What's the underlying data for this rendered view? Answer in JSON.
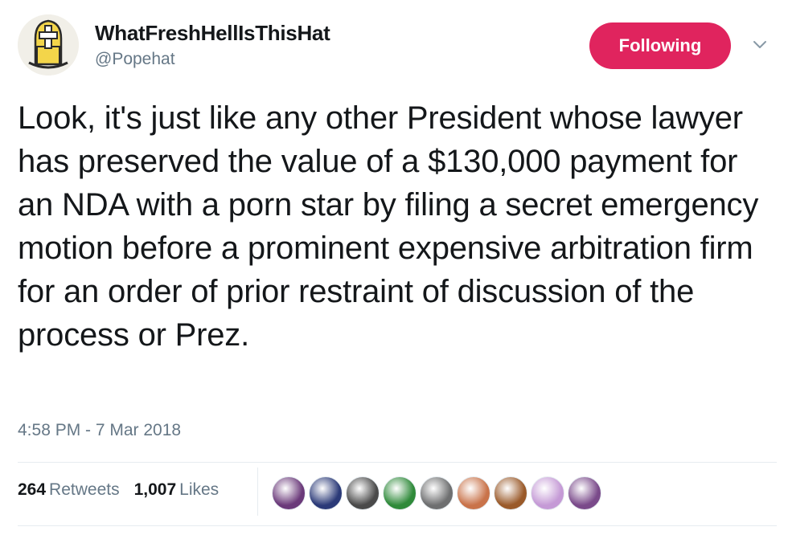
{
  "tweet": {
    "author": {
      "display_name": "WhatFreshHellIsThisHat",
      "handle": "@Popehat"
    },
    "follow_button_label": "Following",
    "text": "Look, it's just like any other President whose lawyer has preserved the value of a $130,000 payment for an NDA with a porn star by filing a secret emergency motion before a prominent expensive arbitration firm for an order of prior restraint of discussion of the process or Prez.",
    "timestamp": "4:58 PM - 7 Mar 2018",
    "stats": {
      "retweets_count": "264",
      "retweets_label": "Retweets",
      "likes_count": "1,007",
      "likes_label": "Likes"
    },
    "likers": [
      {
        "name": "liker-avatar-1",
        "color": "#6b3a7a"
      },
      {
        "name": "liker-avatar-2",
        "color": "#2b3a78"
      },
      {
        "name": "liker-avatar-3",
        "color": "#4a4a4a"
      },
      {
        "name": "liker-avatar-4",
        "color": "#2f8a3a"
      },
      {
        "name": "liker-avatar-5",
        "color": "#6e6f70"
      },
      {
        "name": "liker-avatar-6",
        "color": "#c9734a"
      },
      {
        "name": "liker-avatar-7",
        "color": "#9a5a2a"
      },
      {
        "name": "liker-avatar-8",
        "color": "#c59ad6"
      },
      {
        "name": "liker-avatar-9",
        "color": "#7a4a8a"
      }
    ]
  },
  "colors": {
    "follow_button": "#e0245e",
    "secondary_text": "#657786",
    "primary_text": "#14171a"
  },
  "icons": {
    "avatar": "pope-hat-avatar-icon",
    "caret": "chevron-down-icon"
  }
}
